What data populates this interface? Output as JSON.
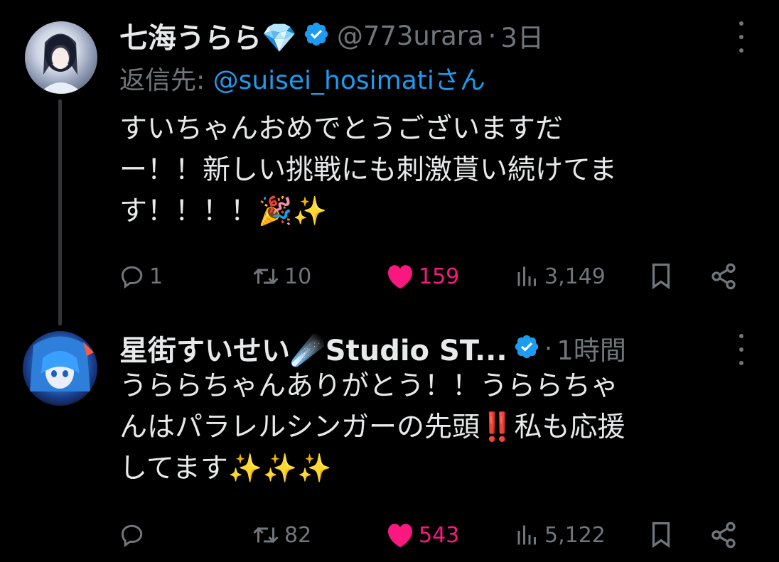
{
  "tweets": [
    {
      "author_name": "七海うらら💎",
      "verified": true,
      "handle": "@773urara",
      "separator": "·",
      "time": "3日",
      "reply_label": "返信先: ",
      "reply_mention": "@suisei_hosimatiさん",
      "body_lines": [
        "すいちゃんおめでとうございますだ",
        "ー！！新しい挑戦にも刺激貰い続けてま",
        "す！！！！🎉✨"
      ],
      "replies": "1",
      "retweets": "10",
      "likes": "159",
      "views": "3,149"
    },
    {
      "author_name": "星街すいせい☄️Studio ST...",
      "verified": true,
      "separator": "·",
      "time": "1時間",
      "body_lines": [
        "うららちゃんありがとう！！うららちゃ",
        "んはパラレルシンガーの先頭‼️私も応援",
        "してます✨✨✨"
      ],
      "replies": "",
      "retweets": "82",
      "likes": "543",
      "views": "5,122"
    }
  ],
  "colors": {
    "background": "#000000",
    "text": "#e7e9ea",
    "muted": "#71767b",
    "link": "#1d9bf0",
    "like": "#f91880",
    "verified": "#1d9bf0"
  },
  "icons": [
    "verified-badge-icon",
    "more-icon",
    "reply-icon",
    "retweet-icon",
    "heart-icon",
    "views-icon",
    "bookmark-icon",
    "share-icon"
  ]
}
